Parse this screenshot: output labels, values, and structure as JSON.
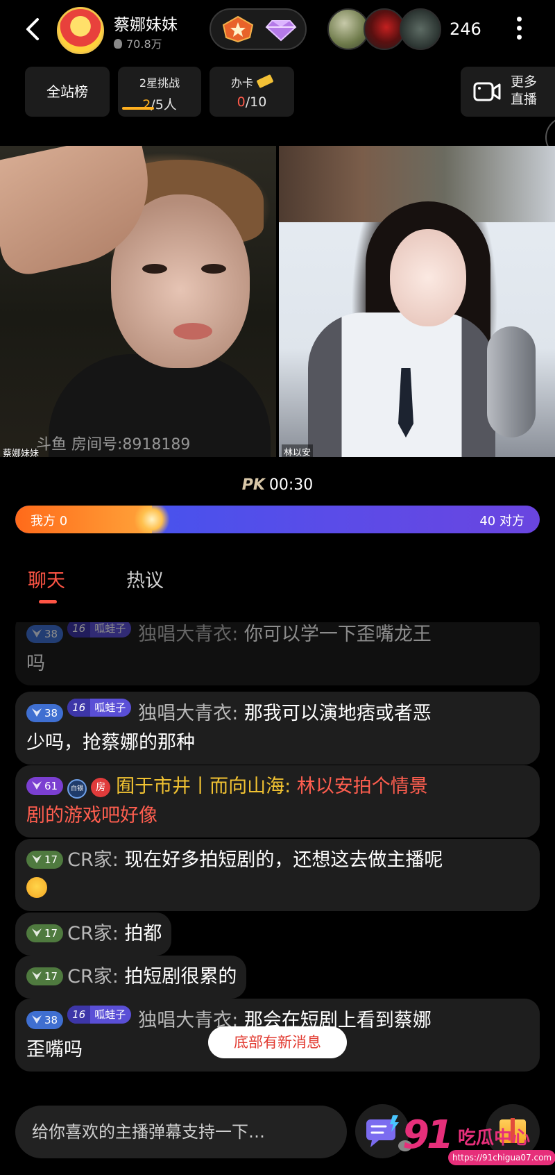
{
  "header": {
    "back_icon": "chevron-left-icon",
    "host_name": "蔡娜妹妹",
    "host_popularity": "70.8万",
    "badges": [
      "level-star-badge-icon",
      "diamond-badge-icon"
    ],
    "viewer_count": "246",
    "more_icon": "more-vertical-icon"
  },
  "tabs": {
    "site_rank": "全站榜",
    "challenge_title": "2星挑战",
    "challenge_done": "2",
    "challenge_total": "/5人",
    "card_title": "办卡",
    "card_done": "0",
    "card_total": "/10",
    "more_live_line1": "更多",
    "more_live_line2": "直播"
  },
  "videos": {
    "left_anchor": "蔡娜妹妹",
    "left_room": "斗鱼 房间号:8918189",
    "right_anchor": "林以安"
  },
  "pk": {
    "label": "PK",
    "timer": "00:30",
    "our_label": "我方 0",
    "their_label": "40 对方",
    "our_share": 0.26
  },
  "chat_tabs": {
    "chat": "聊天",
    "hot": "热议"
  },
  "messages": [
    {
      "level": "38",
      "fan_level": "16",
      "fan_name": "呱蛙子",
      "nick": "独唱大青衣:",
      "line1": "你可以学一下歪嘴龙王",
      "line2": "吗"
    },
    {
      "level": "38",
      "fan_level": "16",
      "fan_name": "呱蛙子",
      "nick": "独唱大青衣:",
      "line1": "那我可以演地痞或者恶",
      "line2": "少吗，抢蔡娜的那种"
    },
    {
      "level": "61",
      "badge": "白银",
      "room": "房",
      "nick": "囿于市井丨而向山海:",
      "line1": "林以安拍个情景",
      "line2": "剧的游戏吧好像"
    },
    {
      "level": "17",
      "nick": "CR家:",
      "line1": "现在好多拍短剧的，还想这去做主播呢"
    },
    {
      "level": "17",
      "nick": "CR家:",
      "line1": "拍都"
    },
    {
      "level": "17",
      "nick": "CR家:",
      "line1": "拍短剧很累的"
    },
    {
      "level": "38",
      "fan_level": "16",
      "fan_name": "呱蛙子",
      "nick": "独唱大青衣:",
      "line1": "那会在短剧上看到蔡娜",
      "line2": "歪嘴吗"
    }
  ],
  "new_messages_hint": "底部有新消息",
  "input": {
    "placeholder": "给你喜欢的主播弹幕支持一下…"
  },
  "watermark": {
    "num": "91",
    "name": "吃瓜中心",
    "url": "https://91chigua07.com"
  },
  "colors": {
    "accent_red": "#ff5545",
    "pk_ours": "#ff7a1f",
    "pk_theirs": "#5a4ce8",
    "challenge_highlight": "#ffb01f"
  }
}
